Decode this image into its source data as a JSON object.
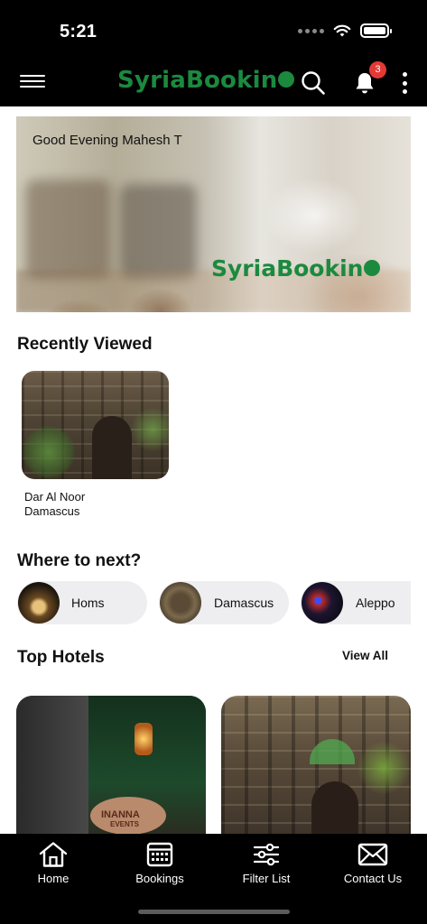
{
  "status_bar": {
    "time": "5:21"
  },
  "app_bar": {
    "logo_text": "SyriaBookin",
    "notification_count": "3",
    "brand_color": "#1b8a3e",
    "icons": [
      "menu-icon",
      "search-icon",
      "bell-icon",
      "more-vertical-icon"
    ]
  },
  "banner": {
    "greeting": "Good Evening Mahesh T",
    "logo_text": "SyriaBookin"
  },
  "recently_viewed": {
    "title": "Recently Viewed",
    "items": [
      {
        "name_line1": "Dar Al Noor",
        "name_line2": "Damascus"
      }
    ]
  },
  "where_to_next": {
    "title": "Where to next?",
    "destinations": [
      {
        "label": "Homs"
      },
      {
        "label": "Damascus"
      },
      {
        "label": "Aleppo"
      }
    ]
  },
  "top_hotels": {
    "title": "Top Hotels",
    "view_all_label": "View All",
    "sign_text_line1": "INANNA",
    "sign_text_line2": "EVENTS"
  },
  "bottom_nav": {
    "items": [
      {
        "label": "Home",
        "icon": "home-icon"
      },
      {
        "label": "Bookings",
        "icon": "calendar-icon"
      },
      {
        "label": "Filter List",
        "icon": "sliders-icon"
      },
      {
        "label": "Contact Us",
        "icon": "mail-icon"
      }
    ]
  }
}
